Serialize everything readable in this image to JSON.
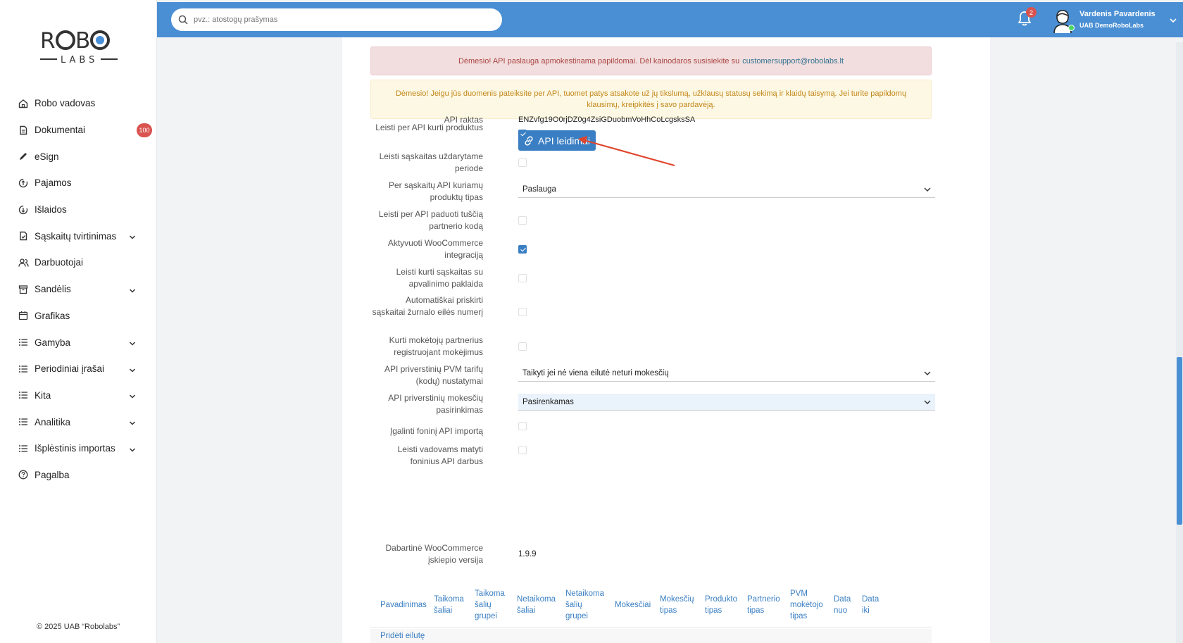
{
  "sidebar": {
    "logo_top": "R",
    "logo_top_rest": "B",
    "logo_bottom": "LABS",
    "items": [
      {
        "label": "Robo vadovas",
        "icon": "home-icon",
        "expandable": false
      },
      {
        "label": "Dokumentai",
        "icon": "document-icon",
        "expandable": false,
        "badge": "100"
      },
      {
        "label": "eSign",
        "icon": "pen-icon",
        "expandable": false
      },
      {
        "label": "Pajamos",
        "icon": "income-icon",
        "expandable": false
      },
      {
        "label": "Išlaidos",
        "icon": "expense-icon",
        "expandable": false
      },
      {
        "label": "Sąskaitų tvirtinimas",
        "icon": "invoice-check-icon",
        "expandable": true
      },
      {
        "label": "Darbuotojai",
        "icon": "users-icon",
        "expandable": false
      },
      {
        "label": "Sandėlis",
        "icon": "archive-icon",
        "expandable": true
      },
      {
        "label": "Grafikas",
        "icon": "calendar-icon",
        "expandable": false
      },
      {
        "label": "Gamyba",
        "icon": "list-icon",
        "expandable": true
      },
      {
        "label": "Periodiniai įrašai",
        "icon": "list-icon",
        "expandable": true
      },
      {
        "label": "Kita",
        "icon": "list-icon",
        "expandable": true
      },
      {
        "label": "Analitika",
        "icon": "list-icon",
        "expandable": true
      },
      {
        "label": "Išplėstinis importas",
        "icon": "list-icon",
        "expandable": true
      },
      {
        "label": "Pagalba",
        "icon": "help-icon",
        "expandable": false
      }
    ],
    "copyright": "© 2025 UAB “Robolabs”"
  },
  "topbar": {
    "search_placeholder": "pvz.: atostogų prašymas",
    "notification_count": "2",
    "user_name": "Vardenis Pavardenis",
    "user_company": "UAB DemoRoboLabs",
    "accent": "#4a8fd4"
  },
  "alerts": {
    "red_text": "Dėmesio! API paslauga apmokestinama papildomai. Dėl kainodaros susisiekite su",
    "red_link": "customersupport@robolabs.lt",
    "yellow_text": "Dėmesio! Jeigu jūs duomenis pateiksite per API, tuomet patys atsakote už jų tikslumą, užklausų statusų sekimą ir klaidų taisymą. Jei turite papildomų klausimų, kreipkitės į savo pardavėją."
  },
  "form": {
    "api_key_label": "API raktas",
    "api_key_value": "ENZvfg19O0rjDZ0g4ZsiGDuobmVoHhCoLcgsksSA",
    "api_button_label": "API leidimai",
    "fields": [
      {
        "label": "Leisti per API kurti produktus",
        "type": "checkbox",
        "checked": true
      },
      {
        "label": "Leisti sąskaitas uždarytame periode",
        "type": "checkbox",
        "checked": false
      },
      {
        "label": "Per sąskaitų API kuriamų produktų tipas",
        "type": "select",
        "value": "Paslauga"
      },
      {
        "label": "Leisti per API paduoti tuščią partnerio kodą",
        "type": "checkbox",
        "checked": false
      },
      {
        "label": "Aktyvuoti WooCommerce integraciją",
        "type": "checkbox",
        "checked": true
      },
      {
        "label": "Leisti kurti sąskaitas su apvalinimo paklaida",
        "type": "checkbox",
        "checked": false
      },
      {
        "label": "Automatiškai priskirti sąskaitai žurnalo eilės numerį",
        "type": "checkbox",
        "checked": false
      },
      {
        "label": "Kurti mokėtojų partnerius registruojant mokėjimus",
        "type": "checkbox",
        "checked": false
      },
      {
        "label": "API priverstinių PVM tarifų (kodų) nustatymai",
        "type": "select",
        "value": "Taikyti jei nė viena eilutė neturi mokesčių"
      },
      {
        "label": "API priverstinių mokesčių pasirinkimas",
        "type": "select",
        "value": "Pasirenkamas"
      },
      {
        "label": "Įgalinti foninį API importą",
        "type": "checkbox",
        "checked": false
      },
      {
        "label": "Leisti vadovams matyti foninius API darbus",
        "type": "checkbox",
        "checked": false
      }
    ],
    "version_label": "Dabartinė WooCommerce įskiepio versija",
    "version_value": "1.9.9"
  },
  "table": {
    "headers": [
      "Pavadinimas",
      "Taikoma šaliai",
      "Taikoma šalių grupei",
      "Netaikoma šaliai",
      "Netaikoma šalių grupei",
      "Mokesčiai",
      "Mokesčių tipas",
      "Produkto tipas",
      "Partnerio tipas",
      "PVM mokėtojo tipas",
      "Data nuo",
      "Data iki"
    ],
    "add_row": "Pridėti eilutę"
  }
}
